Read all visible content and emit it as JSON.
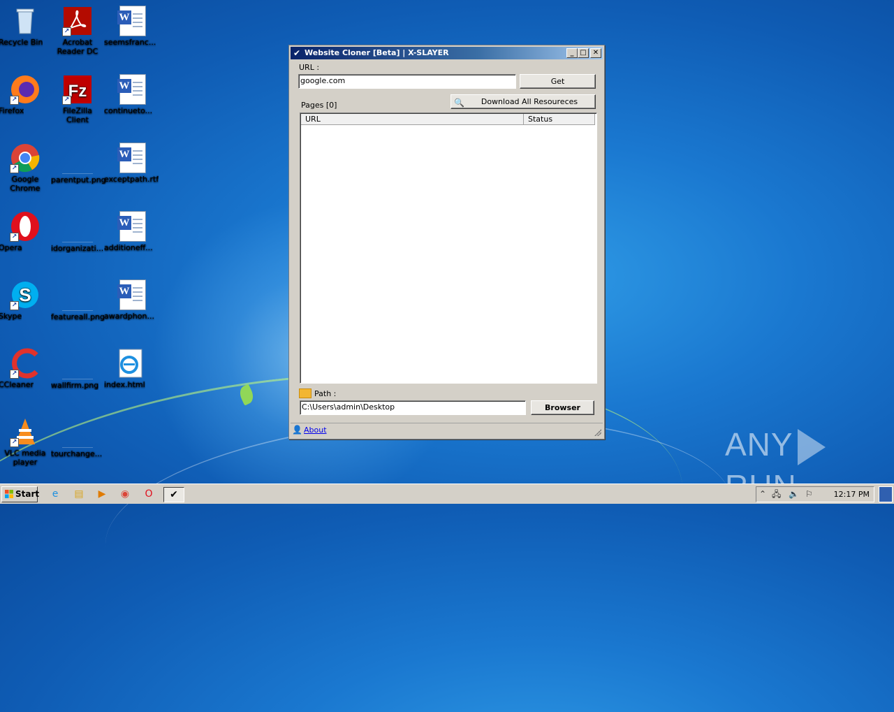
{
  "desktop": {
    "icons": [
      {
        "label": "Recycle Bin"
      },
      {
        "label": "Acrobat Reader DC"
      },
      {
        "label": "seemsfranc..."
      },
      {
        "label": "Firefox"
      },
      {
        "label": "FileZilla Client"
      },
      {
        "label": "continueto..."
      },
      {
        "label": "Google Chrome"
      },
      {
        "label": "parentput.png"
      },
      {
        "label": "exceptpath.rtf"
      },
      {
        "label": "Opera"
      },
      {
        "label": "idorganizati..."
      },
      {
        "label": "additioneff..."
      },
      {
        "label": "Skype"
      },
      {
        "label": "featureall.png"
      },
      {
        "label": "awardphon..."
      },
      {
        "label": "CCleaner"
      },
      {
        "label": "wallfirm.png"
      },
      {
        "label": "index.html"
      },
      {
        "label": "VLC media player"
      },
      {
        "label": "tourchange..."
      }
    ]
  },
  "window": {
    "title": "Website Cloner [Beta] | X-SLAYER",
    "minimize": "_",
    "maximize": "□",
    "close": "✕",
    "url_label": "URL :",
    "url_value": "google.com",
    "get_button": "Get",
    "download_button": "Download All Resoureces",
    "pages_label": "Pages [0]",
    "columns": [
      "URL",
      "Status"
    ],
    "path_label": "Path :",
    "path_value": "C:\\Users\\admin\\Desktop",
    "browser_button": "Browser",
    "about_link": "About"
  },
  "taskbar": {
    "start_label": "Start",
    "clock": "12:17 PM"
  },
  "watermark": {
    "left": "ANY",
    "right": "RUN"
  },
  "colors": {
    "titlebar_start": "#0a246a",
    "desktop": "#1a78d0"
  }
}
